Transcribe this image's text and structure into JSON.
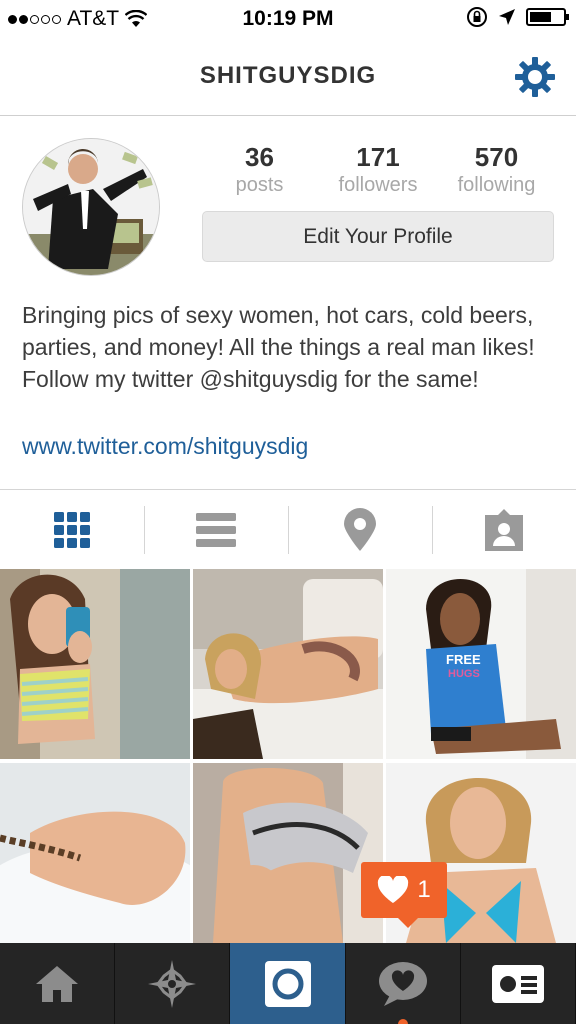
{
  "status_bar": {
    "carrier": "AT&T",
    "signal_bars_filled": 2,
    "signal_bars_total": 5,
    "time": "10:19 PM",
    "battery_level": 0.65
  },
  "header": {
    "title": "SHITGUYSDIG",
    "settings_icon": "gear-icon"
  },
  "profile": {
    "stats": [
      {
        "value": "36",
        "label": "posts"
      },
      {
        "value": "171",
        "label": "followers"
      },
      {
        "value": "570",
        "label": "following"
      }
    ],
    "edit_button": "Edit Your Profile",
    "bio": "Bringing pics of sexy women, hot cars, cold beers, parties, and money! All the things a real man likes! Follow my twitter @shitguysdig for the same!",
    "link": "www.twitter.com/shitguysdig"
  },
  "view_tabs": [
    {
      "icon": "grid-icon",
      "active": true
    },
    {
      "icon": "list-icon",
      "active": false
    },
    {
      "icon": "location-pin-icon",
      "active": false
    },
    {
      "icon": "tagged-person-icon",
      "active": false
    }
  ],
  "notification": {
    "icon": "heart-icon",
    "count": "1"
  },
  "bottom_tabs": [
    {
      "icon": "home-icon",
      "active": false
    },
    {
      "icon": "explore-star-icon",
      "active": false
    },
    {
      "icon": "camera-icon",
      "active": true
    },
    {
      "icon": "activity-speech-heart-icon",
      "active": false
    },
    {
      "icon": "profile-card-icon",
      "active": false
    }
  ],
  "colors": {
    "accent_blue": "#1f5f99",
    "active_tab": "#2d5f8d",
    "notification_orange": "#f0632a",
    "tab_bar": "#252525"
  }
}
